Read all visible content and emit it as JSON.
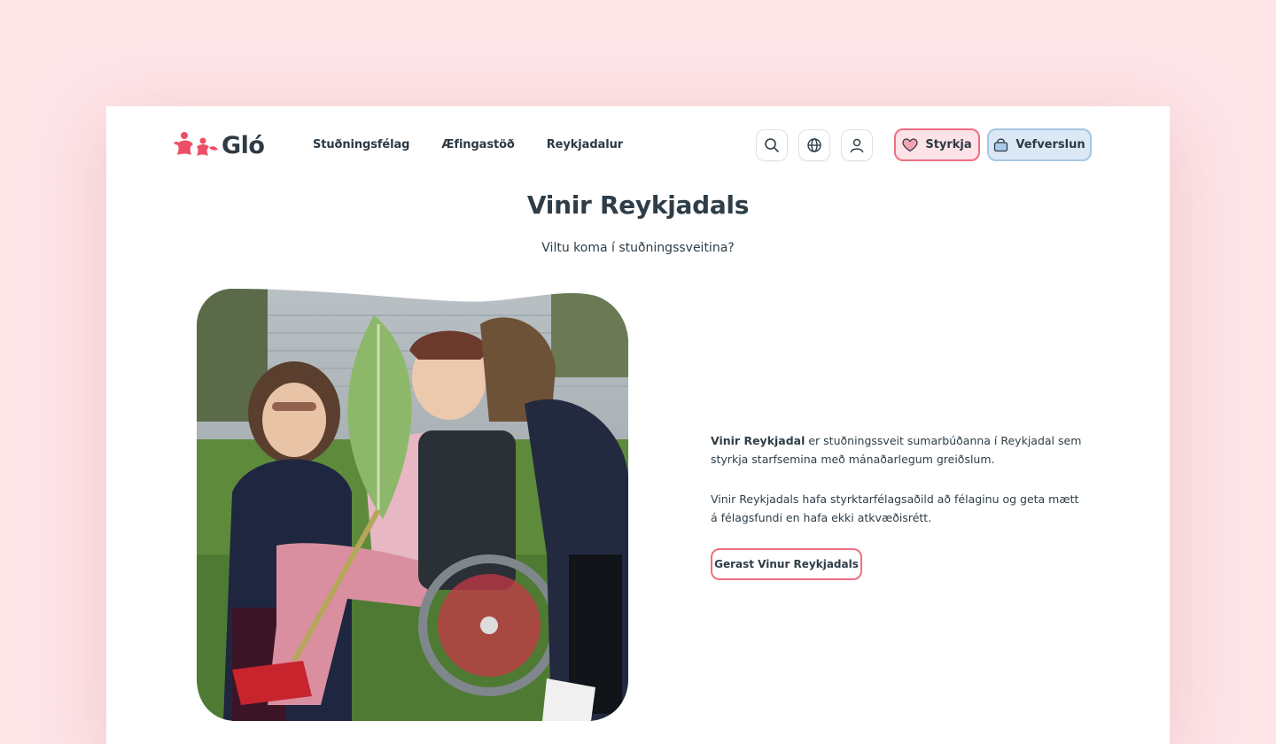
{
  "header": {
    "logo_text": "Gló",
    "nav": [
      {
        "label": "Stuðningsfélag"
      },
      {
        "label": "Æfingastöð"
      },
      {
        "label": "Reykjadalur"
      }
    ],
    "icons": [
      "search-icon",
      "globe-icon",
      "user-icon"
    ],
    "donate_label": "Styrkja",
    "shop_label": "Vefverslun"
  },
  "hero": {
    "title": "Vinir Reykjadals",
    "subtitle": "Viltu koma í stuðningssveitina?"
  },
  "content": {
    "p1_bold": "Vinir Reykjadal",
    "p1_rest": " er stuðningssveit sumarbúðanna í Reykjadal sem styrkja starfsemina með mánaðarlegum greiðslum.",
    "p2": "Vinir Reykjadals hafa styrktarfélagsaðild að félaginu og geta mætt á félagsfundi en hafa ekki atkvæðisrétt.",
    "cta_label": "Gerast Vinur Reykjadals"
  },
  "colors": {
    "background": "#fde5e8",
    "accent_pink": "#ef6f82",
    "accent_blue": "#a6c6e3",
    "text": "#2e3d47"
  }
}
